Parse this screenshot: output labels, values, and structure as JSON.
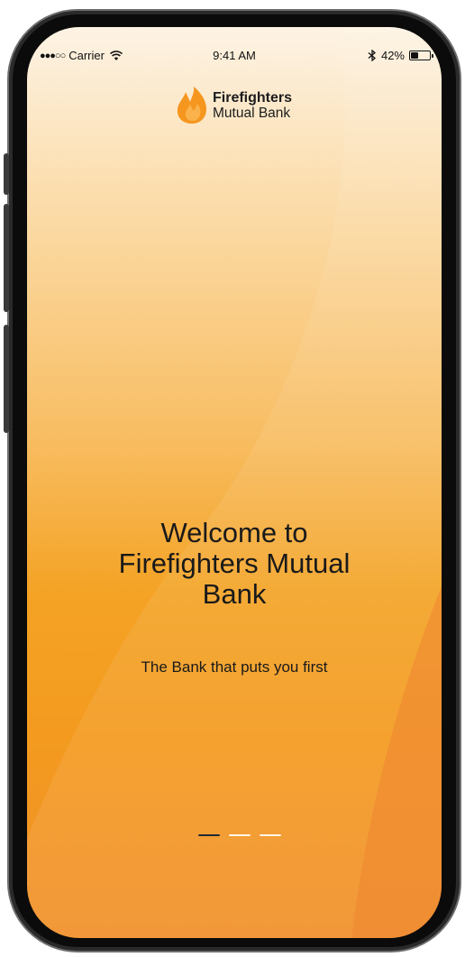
{
  "status_bar": {
    "signal": "●●●○○",
    "carrier": "Carrier",
    "time": "9:41 AM",
    "battery_percent": "42%",
    "battery_level": 0.42
  },
  "logo": {
    "line1": "Firefighters",
    "line2": "Mutual Bank",
    "icon": "flame-icon"
  },
  "welcome": {
    "title": "Welcome to\nFirefighters Mutual\nBank",
    "subtitle": "The Bank that puts you first"
  },
  "pager": {
    "pages": 3,
    "active_index": 0
  },
  "colors": {
    "gradient_top": "#fdf3e4",
    "gradient_bottom": "#f1902a",
    "flame": "#f5961f",
    "text": "#1a1a1a",
    "pager_active": "#1e2a36",
    "pager_inactive": "#fff6e8"
  }
}
